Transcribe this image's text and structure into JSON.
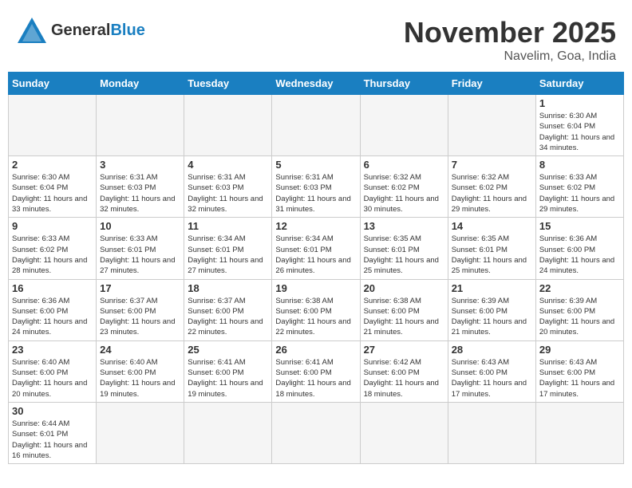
{
  "header": {
    "logo_general": "General",
    "logo_blue": "Blue",
    "month_title": "November 2025",
    "subtitle": "Navelim, Goa, India"
  },
  "weekdays": [
    "Sunday",
    "Monday",
    "Tuesday",
    "Wednesday",
    "Thursday",
    "Friday",
    "Saturday"
  ],
  "weeks": [
    [
      {
        "day": "",
        "info": ""
      },
      {
        "day": "",
        "info": ""
      },
      {
        "day": "",
        "info": ""
      },
      {
        "day": "",
        "info": ""
      },
      {
        "day": "",
        "info": ""
      },
      {
        "day": "",
        "info": ""
      },
      {
        "day": "1",
        "info": "Sunrise: 6:30 AM\nSunset: 6:04 PM\nDaylight: 11 hours\nand 34 minutes."
      }
    ],
    [
      {
        "day": "2",
        "info": "Sunrise: 6:30 AM\nSunset: 6:04 PM\nDaylight: 11 hours\nand 33 minutes."
      },
      {
        "day": "3",
        "info": "Sunrise: 6:31 AM\nSunset: 6:03 PM\nDaylight: 11 hours\nand 32 minutes."
      },
      {
        "day": "4",
        "info": "Sunrise: 6:31 AM\nSunset: 6:03 PM\nDaylight: 11 hours\nand 32 minutes."
      },
      {
        "day": "5",
        "info": "Sunrise: 6:31 AM\nSunset: 6:03 PM\nDaylight: 11 hours\nand 31 minutes."
      },
      {
        "day": "6",
        "info": "Sunrise: 6:32 AM\nSunset: 6:02 PM\nDaylight: 11 hours\nand 30 minutes."
      },
      {
        "day": "7",
        "info": "Sunrise: 6:32 AM\nSunset: 6:02 PM\nDaylight: 11 hours\nand 29 minutes."
      },
      {
        "day": "8",
        "info": "Sunrise: 6:33 AM\nSunset: 6:02 PM\nDaylight: 11 hours\nand 29 minutes."
      }
    ],
    [
      {
        "day": "9",
        "info": "Sunrise: 6:33 AM\nSunset: 6:02 PM\nDaylight: 11 hours\nand 28 minutes."
      },
      {
        "day": "10",
        "info": "Sunrise: 6:33 AM\nSunset: 6:01 PM\nDaylight: 11 hours\nand 27 minutes."
      },
      {
        "day": "11",
        "info": "Sunrise: 6:34 AM\nSunset: 6:01 PM\nDaylight: 11 hours\nand 27 minutes."
      },
      {
        "day": "12",
        "info": "Sunrise: 6:34 AM\nSunset: 6:01 PM\nDaylight: 11 hours\nand 26 minutes."
      },
      {
        "day": "13",
        "info": "Sunrise: 6:35 AM\nSunset: 6:01 PM\nDaylight: 11 hours\nand 25 minutes."
      },
      {
        "day": "14",
        "info": "Sunrise: 6:35 AM\nSunset: 6:01 PM\nDaylight: 11 hours\nand 25 minutes."
      },
      {
        "day": "15",
        "info": "Sunrise: 6:36 AM\nSunset: 6:00 PM\nDaylight: 11 hours\nand 24 minutes."
      }
    ],
    [
      {
        "day": "16",
        "info": "Sunrise: 6:36 AM\nSunset: 6:00 PM\nDaylight: 11 hours\nand 24 minutes."
      },
      {
        "day": "17",
        "info": "Sunrise: 6:37 AM\nSunset: 6:00 PM\nDaylight: 11 hours\nand 23 minutes."
      },
      {
        "day": "18",
        "info": "Sunrise: 6:37 AM\nSunset: 6:00 PM\nDaylight: 11 hours\nand 22 minutes."
      },
      {
        "day": "19",
        "info": "Sunrise: 6:38 AM\nSunset: 6:00 PM\nDaylight: 11 hours\nand 22 minutes."
      },
      {
        "day": "20",
        "info": "Sunrise: 6:38 AM\nSunset: 6:00 PM\nDaylight: 11 hours\nand 21 minutes."
      },
      {
        "day": "21",
        "info": "Sunrise: 6:39 AM\nSunset: 6:00 PM\nDaylight: 11 hours\nand 21 minutes."
      },
      {
        "day": "22",
        "info": "Sunrise: 6:39 AM\nSunset: 6:00 PM\nDaylight: 11 hours\nand 20 minutes."
      }
    ],
    [
      {
        "day": "23",
        "info": "Sunrise: 6:40 AM\nSunset: 6:00 PM\nDaylight: 11 hours\nand 20 minutes."
      },
      {
        "day": "24",
        "info": "Sunrise: 6:40 AM\nSunset: 6:00 PM\nDaylight: 11 hours\nand 19 minutes."
      },
      {
        "day": "25",
        "info": "Sunrise: 6:41 AM\nSunset: 6:00 PM\nDaylight: 11 hours\nand 19 minutes."
      },
      {
        "day": "26",
        "info": "Sunrise: 6:41 AM\nSunset: 6:00 PM\nDaylight: 11 hours\nand 18 minutes."
      },
      {
        "day": "27",
        "info": "Sunrise: 6:42 AM\nSunset: 6:00 PM\nDaylight: 11 hours\nand 18 minutes."
      },
      {
        "day": "28",
        "info": "Sunrise: 6:43 AM\nSunset: 6:00 PM\nDaylight: 11 hours\nand 17 minutes."
      },
      {
        "day": "29",
        "info": "Sunrise: 6:43 AM\nSunset: 6:00 PM\nDaylight: 11 hours\nand 17 minutes."
      }
    ],
    [
      {
        "day": "30",
        "info": "Sunrise: 6:44 AM\nSunset: 6:01 PM\nDaylight: 11 hours\nand 16 minutes."
      },
      {
        "day": "",
        "info": ""
      },
      {
        "day": "",
        "info": ""
      },
      {
        "day": "",
        "info": ""
      },
      {
        "day": "",
        "info": ""
      },
      {
        "day": "",
        "info": ""
      },
      {
        "day": "",
        "info": ""
      }
    ]
  ]
}
